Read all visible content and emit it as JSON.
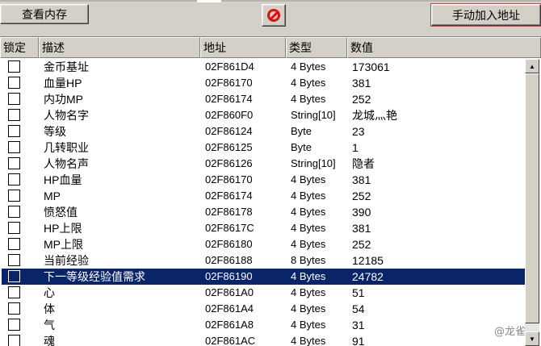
{
  "toolbar": {
    "view_memory_label": "查看内存",
    "stop_icon": "stop-icon",
    "add_address_label": "手动加入地址"
  },
  "columns": {
    "lock": "锁定",
    "desc": "描述",
    "addr": "地址",
    "type": "类型",
    "value": "数值"
  },
  "rows": [
    {
      "desc": "金币基址",
      "addr": "02F861D4",
      "type": "4 Bytes",
      "value": "173061"
    },
    {
      "desc": "血量HP",
      "addr": "02F86170",
      "type": "4 Bytes",
      "value": "381"
    },
    {
      "desc": "内功MP",
      "addr": "02F86174",
      "type": "4 Bytes",
      "value": "252"
    },
    {
      "desc": "人物名字",
      "addr": "02F860F0",
      "type": "String[10]",
      "value": "龙城灬艳"
    },
    {
      "desc": "等级",
      "addr": "02F86124",
      "type": "Byte",
      "value": "23"
    },
    {
      "desc": "几转职业",
      "addr": "02F86125",
      "type": "Byte",
      "value": "1"
    },
    {
      "desc": "人物名声",
      "addr": "02F86126",
      "type": "String[10]",
      "value": "隐者"
    },
    {
      "desc": "HP血量",
      "addr": "02F86170",
      "type": "4 Bytes",
      "value": "381"
    },
    {
      "desc": "MP",
      "addr": "02F86174",
      "type": "4 Bytes",
      "value": "252"
    },
    {
      "desc": "愤怒值",
      "addr": "02F86178",
      "type": "4 Bytes",
      "value": "390"
    },
    {
      "desc": "HP上限",
      "addr": "02F8617C",
      "type": "4 Bytes",
      "value": "381"
    },
    {
      "desc": "MP上限",
      "addr": "02F86180",
      "type": "4 Bytes",
      "value": "252"
    },
    {
      "desc": "当前经验",
      "addr": "02F86188",
      "type": "8 Bytes",
      "value": "12185"
    },
    {
      "desc": "下一等级经验值需求",
      "addr": "02F86190",
      "type": "4 Bytes",
      "value": "24782",
      "selected": true
    },
    {
      "desc": "心",
      "addr": "02F861A0",
      "type": "4 Bytes",
      "value": "51"
    },
    {
      "desc": "体",
      "addr": "02F861A4",
      "type": "4 Bytes",
      "value": "54"
    },
    {
      "desc": "气",
      "addr": "02F861A8",
      "type": "4 Bytes",
      "value": "31"
    },
    {
      "desc": "魂",
      "addr": "02F861AC",
      "type": "4 Bytes",
      "value": "91"
    }
  ],
  "watermark": "@龙雀"
}
